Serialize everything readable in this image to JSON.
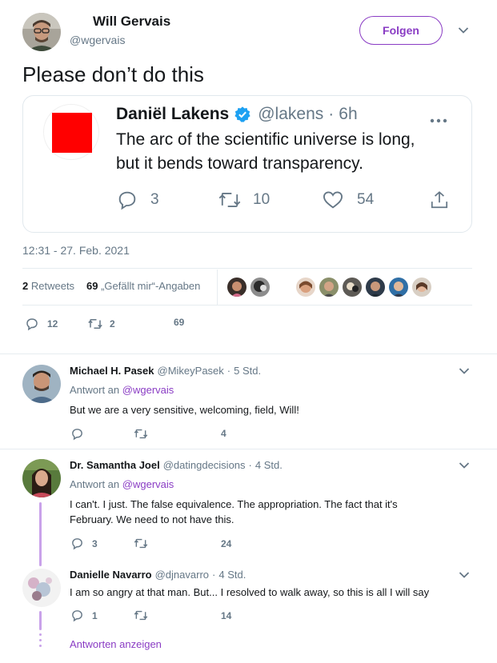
{
  "author": {
    "name": "Will Gervais",
    "handle": "@wgervais",
    "follow_label": "Folgen"
  },
  "tweet": {
    "text": "Please don’t do this",
    "timestamp": "12:31 - 27. Feb. 2021"
  },
  "quoted": {
    "name": "Daniël Lakens",
    "handle": "@lakens",
    "sep": "·",
    "time": "6h",
    "text_line1": "The arc of the scientific universe is long,",
    "text_line2": "but it bends toward transparency.",
    "replies": "3",
    "retweets": "10",
    "likes": "54",
    "avatar_color": "#ff0000"
  },
  "engagement": {
    "retweets_count": "2",
    "retweets_label": "Retweets",
    "likes_count": "69",
    "likes_label": "„Gefällt mir“-Angaben"
  },
  "actions": {
    "replies": "12",
    "retweets": "2",
    "likes": "69"
  },
  "replies": [
    {
      "name": "Michael H. Pasek",
      "handle": "@MikeyPasek",
      "sep": "·",
      "time": "5 Std.",
      "reply_to_prefix": "Antwort an",
      "reply_to": "@wgervais",
      "text": "But we are a very sensitive, welcoming, field, Will!",
      "reply_count": "",
      "retweet_count": "",
      "like_count": "4"
    },
    {
      "name": "Dr. Samantha Joel",
      "handle": "@datingdecisions",
      "sep": "·",
      "time": "4 Std.",
      "reply_to_prefix": "Antwort an",
      "reply_to": "@wgervais",
      "text_line1": "I can't. I just. The false equivalence. The appropriation. The fact that it's",
      "text_line2": "February. We need to not have this.",
      "reply_count": "3",
      "retweet_count": "",
      "like_count": "24"
    },
    {
      "name": "Danielle Navarro",
      "handle": "@djnavarro",
      "sep": "·",
      "time": "4 Std.",
      "text": "I am so angry at that man. But... I resolved to walk away, so this is all I will say",
      "reply_count": "1",
      "retweet_count": "",
      "like_count": "14"
    }
  ],
  "show_replies_label": "Antworten anzeigen",
  "colors": {
    "accent": "#8a3cc4",
    "verified": "#1da1f2",
    "thread_line": "#c9a2ea",
    "muted": "#657786"
  }
}
